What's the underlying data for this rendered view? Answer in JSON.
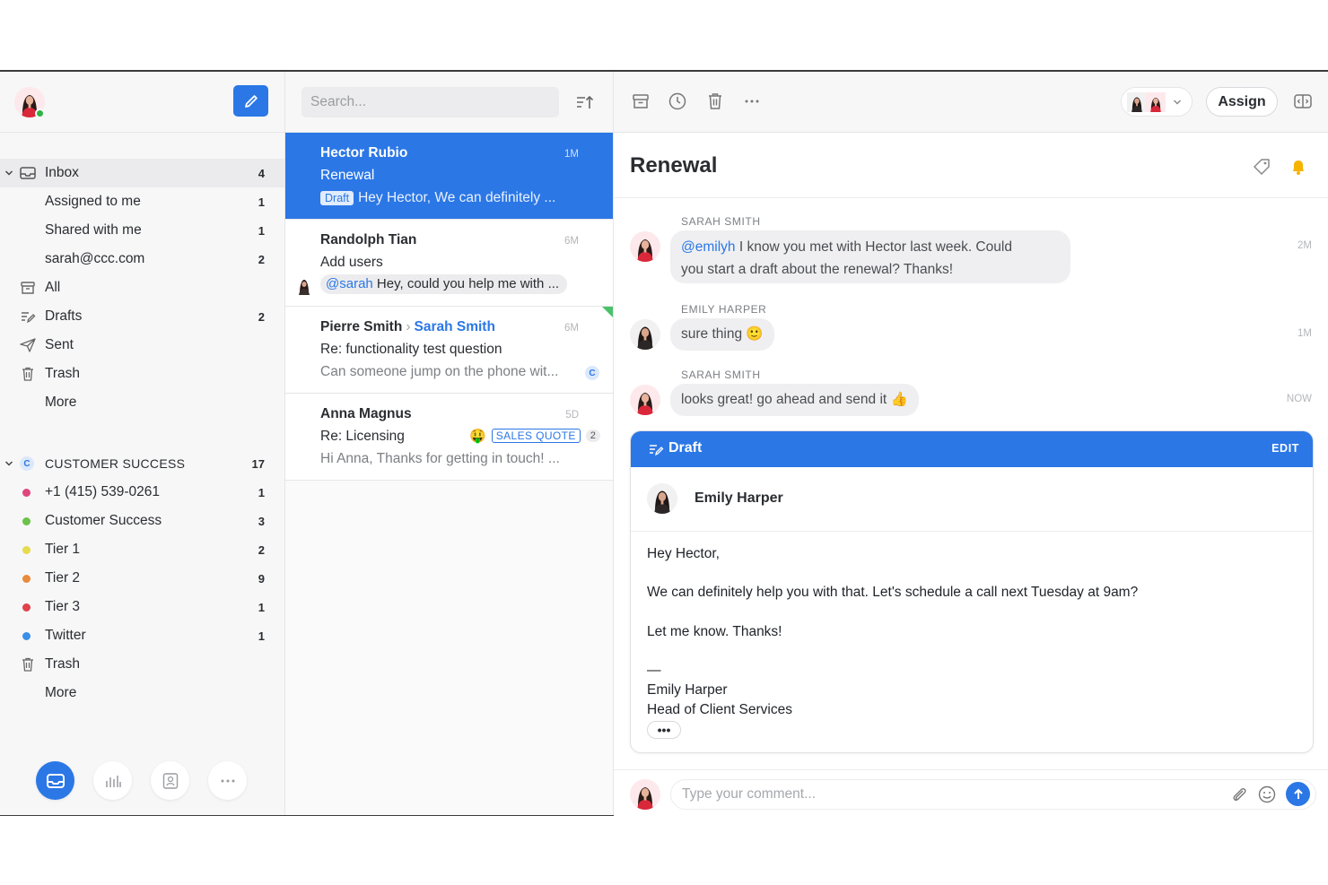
{
  "sidebar": {
    "nav": [
      {
        "label": "Inbox",
        "count": "4"
      },
      {
        "label": "Assigned to me",
        "count": "1"
      },
      {
        "label": "Shared with me",
        "count": "1"
      },
      {
        "label": "sarah@ccc.com",
        "count": "2"
      },
      {
        "label": "All",
        "count": ""
      },
      {
        "label": "Drafts",
        "count": "2"
      },
      {
        "label": "Sent",
        "count": ""
      },
      {
        "label": "Trash",
        "count": ""
      },
      {
        "label": "More",
        "count": ""
      }
    ],
    "team": {
      "badge": "C",
      "label": "CUSTOMER SUCCESS",
      "count": "17",
      "items": [
        {
          "label": "+1 (415) 539-0261",
          "count": "1",
          "color": "#e0457b"
        },
        {
          "label": "Customer Success",
          "count": "3",
          "color": "#6cc24a"
        },
        {
          "label": "Tier 1",
          "count": "2",
          "color": "#e6db4c"
        },
        {
          "label": "Tier 2",
          "count": "9",
          "color": "#e98a3c"
        },
        {
          "label": "Tier 3",
          "count": "1",
          "color": "#e0414a"
        },
        {
          "label": "Twitter",
          "count": "1",
          "color": "#3b8fe6"
        },
        {
          "label": "Trash",
          "count": ""
        },
        {
          "label": "More",
          "count": ""
        }
      ]
    }
  },
  "list": {
    "search_placeholder": "Search...",
    "conversations": [
      {
        "name": "Hector Rubio",
        "time": "1M",
        "subject": "Renewal",
        "draft_tag": "Draft",
        "preview": "Hey Hector, We can definitely ..."
      },
      {
        "name": "Randolph Tian",
        "time": "6M",
        "subject": "Add users",
        "mention": "@sarah",
        "preview": " Hey, could you help me with ..."
      },
      {
        "name": "Pierre Smith",
        "to": "Sarah Smith",
        "time": "6M",
        "subject": "Re: functionality test question",
        "preview": "Can someone jump on the phone wit...",
        "badge": "C"
      },
      {
        "name": "Anna Magnus",
        "time": "5D",
        "subject": "Re: Licensing",
        "emoji": "🤑",
        "tag": "SALES QUOTE",
        "tag_count": "2",
        "preview": "Hi Anna, Thanks for getting in touch! ..."
      }
    ]
  },
  "main": {
    "assign_label": "Assign",
    "title": "Renewal",
    "messages": [
      {
        "author": "SARAH SMITH",
        "mention": "@emilyh",
        "text_line1": " I know you met with Hector last week. Could",
        "text_line2": "you start a draft about the renewal? Thanks!",
        "time": "2M"
      },
      {
        "author": "EMILY HARPER",
        "text": "sure thing ",
        "emoji": "🙂",
        "time": "1M"
      },
      {
        "author": "SARAH SMITH",
        "text": "looks great! go ahead and send it ",
        "emoji": "👍",
        "time": "NOW"
      }
    ],
    "draft": {
      "label": "Draft",
      "edit": "EDIT",
      "from": "Emily Harper",
      "greeting": "Hey Hector,",
      "body": "We can definitely help you with that. Let's schedule a call next Tuesday at 9am?",
      "closing": "Let me know. Thanks!",
      "sig_dash": "—",
      "sig_name": "Emily Harper",
      "sig_title": "Head of Client Services",
      "more": "•••"
    },
    "comment_placeholder": "Type your comment..."
  }
}
